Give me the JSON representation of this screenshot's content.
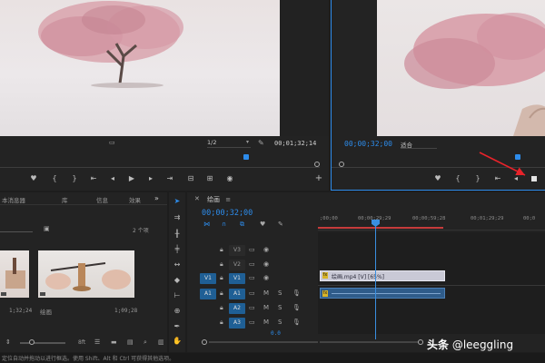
{
  "source_monitor": {
    "zoom": "1/2",
    "timecode": "00;01;32;14",
    "wrench_icon": "wrench-icon"
  },
  "program_monitor": {
    "timecode": "00;00;32;00",
    "fit": "适合"
  },
  "project_panel": {
    "tabs": [
      "本消息器",
      "库",
      "信息",
      "效果"
    ],
    "count": "2 个项",
    "clips": [
      {
        "name": "",
        "duration": "1;32;24"
      },
      {
        "name": "绘画",
        "duration": "1;09;28"
      }
    ],
    "footer_label": "8ft"
  },
  "timeline": {
    "tab_label": "绘画",
    "timecode": "00;00;32;00",
    "ruler": [
      ";00;00",
      "00;00;29;29",
      "00;00;59;28",
      "00;01;29;29",
      "00;0"
    ],
    "tracks": [
      {
        "label": "V3",
        "src": "",
        "type": "video"
      },
      {
        "label": "V2",
        "src": "",
        "type": "video"
      },
      {
        "label": "V1",
        "src": "V1",
        "type": "video"
      },
      {
        "label": "A1",
        "src": "A1",
        "type": "audio"
      },
      {
        "label": "A2",
        "src": "",
        "type": "audio"
      },
      {
        "label": "A3",
        "src": "",
        "type": "audio"
      }
    ],
    "m_label": "M",
    "s_label": "S",
    "video_clip": "绘画.mp4 [V] [65%]",
    "volume": "0.0"
  },
  "status_bar": {
    "hint": "定位自动并拖动以进行框选。使用 Shift、Alt 和 Ctrl 可获得其他选项。"
  },
  "watermark": {
    "prefix": "头条",
    "handle": "@leeggling"
  },
  "colors": {
    "accent": "#2d8ceb",
    "annotation_red": "#e8232a",
    "clip_video": "#c9c9d6",
    "clip_audio": "#2f5c8a"
  }
}
